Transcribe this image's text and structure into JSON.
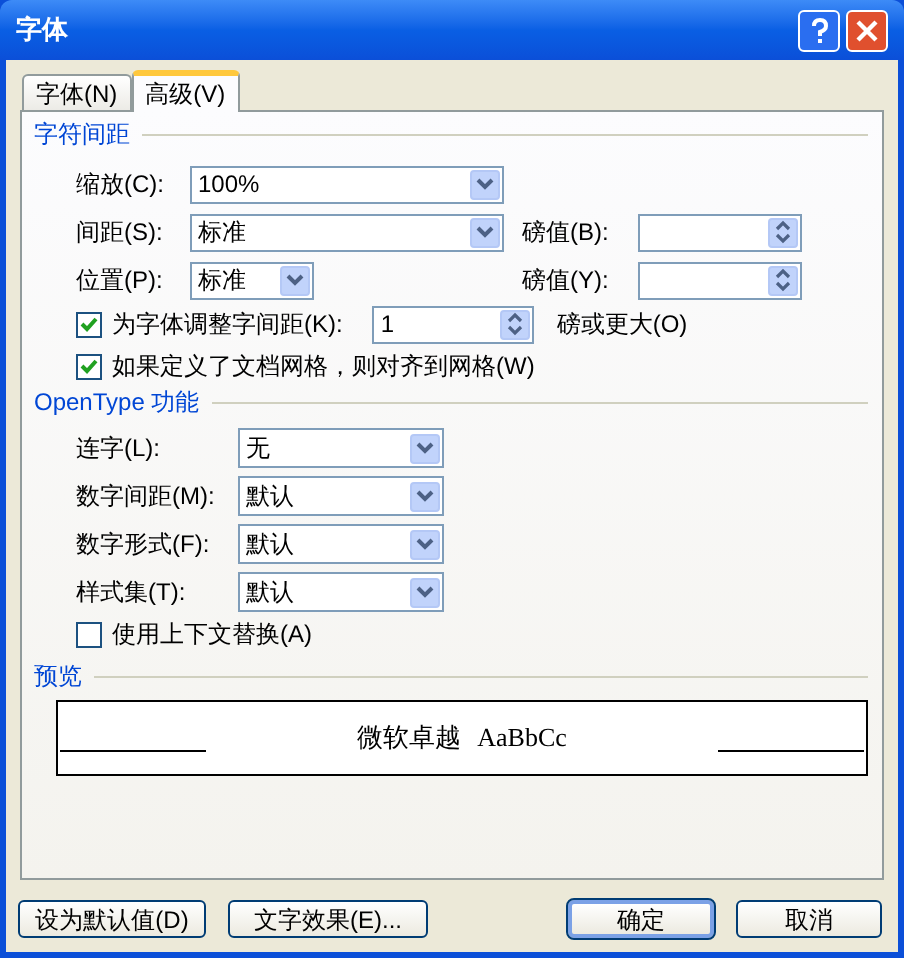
{
  "window": {
    "title": "字体"
  },
  "tabs": [
    {
      "label": "字体(N)",
      "selected": false
    },
    {
      "label": "高级(V)",
      "selected": true
    }
  ],
  "character_spacing": {
    "heading": "字符间距",
    "scale": {
      "label": "缩放(C):",
      "value": "100%"
    },
    "spacing": {
      "label": "间距(S):",
      "value": "标准",
      "points_label": "磅值(B):"
    },
    "position": {
      "label": "位置(P):",
      "value": "标准",
      "points_label": "磅值(Y):"
    },
    "kerning": {
      "label": "为字体调整字间距(K):",
      "checked": true,
      "value": "1",
      "suffix": "磅或更大(O)"
    },
    "snap_to_grid": {
      "label": "如果定义了文档网格，则对齐到网格(W)",
      "checked": true
    }
  },
  "opentype": {
    "heading": "OpenType 功能",
    "fields": [
      {
        "label": "连字(L):",
        "value": "无"
      },
      {
        "label": "数字间距(M):",
        "value": "默认"
      },
      {
        "label": "数字形式(F):",
        "value": "默认"
      },
      {
        "label": "样式集(T):",
        "value": "默认"
      }
    ],
    "contextual_alternates": {
      "label": "使用上下文替换(A)",
      "checked": false
    }
  },
  "preview": {
    "heading": "预览",
    "sample": "微软卓越",
    "sample_latin": "AaBbCc"
  },
  "buttons": [
    {
      "label": "设为默认值(D)",
      "default": false
    },
    {
      "label": "文字效果(E)...",
      "default": false
    },
    {
      "label": "确定",
      "default": true
    },
    {
      "label": "取消",
      "default": false
    }
  ]
}
